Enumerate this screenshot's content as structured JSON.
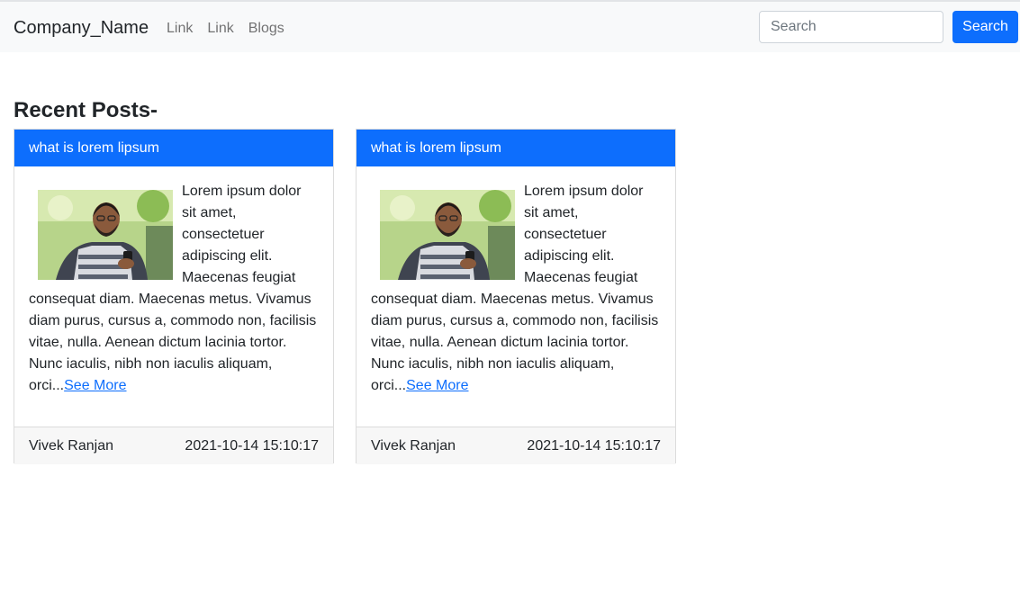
{
  "navbar": {
    "brand": "Company_Name",
    "links": [
      "Link",
      "Link",
      "Blogs"
    ],
    "search_placeholder": "Search",
    "search_button": "Search"
  },
  "main": {
    "section_title": "Recent Posts-",
    "posts": [
      {
        "title": "what is lorem lipsum",
        "excerpt": "Lorem ipsum dolor sit amet, consectetuer adipiscing elit. Maecenas feugiat consequat diam. Maecenas metus. Vivamus diam purus, cursus a, commodo non, facilisis vitae, nulla. Aenean dictum lacinia tortor. Nunc iaculis, nibh non iaculis aliquam, orci...",
        "see_more": "See More",
        "author": "Vivek Ranjan",
        "date": "2021-10-14 15:10:17"
      },
      {
        "title": "what is lorem lipsum",
        "excerpt": "Lorem ipsum dolor sit amet, consectetuer adipiscing elit. Maecenas feugiat consequat diam. Maecenas metus. Vivamus diam purus, cursus a, commodo non, facilisis vitae, nulla. Aenean dictum lacinia tortor. Nunc iaculis, nibh non iaculis aliquam, orci...",
        "see_more": "See More",
        "author": "Vivek Ranjan",
        "date": "2021-10-14 15:10:17"
      }
    ]
  },
  "colors": {
    "primary": "#0d6efd",
    "navbar_bg": "#f8f9fa",
    "footer_bg": "#f7f7f7"
  }
}
